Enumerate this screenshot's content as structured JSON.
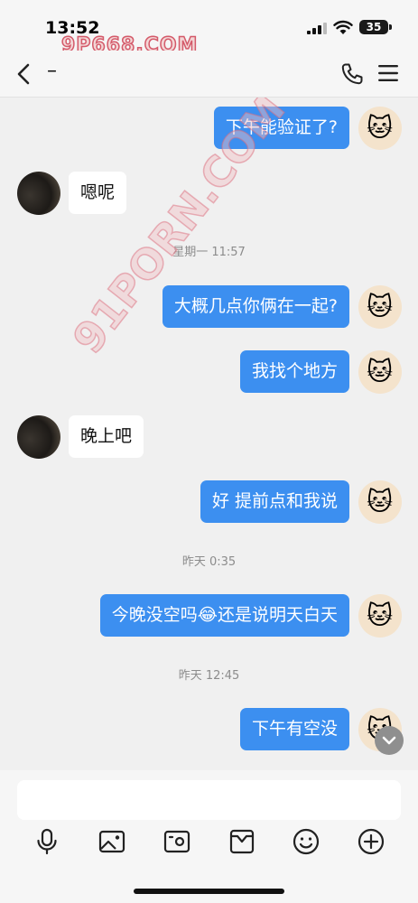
{
  "status_bar": {
    "time": "13:52",
    "battery": "35",
    "watermark": "9P668.COM"
  },
  "nav": {
    "contact_name": "–"
  },
  "watermark_diagonal": "91PORN.COM",
  "messages": [
    {
      "side": "out",
      "text": "下午能验证了?"
    },
    {
      "side": "in",
      "text": "嗯呢"
    },
    {
      "type": "time",
      "text": "星期一 11:57"
    },
    {
      "side": "out",
      "text": "大概几点你俩在一起?"
    },
    {
      "side": "out",
      "text": "我找个地方"
    },
    {
      "side": "in",
      "text": "晚上吧"
    },
    {
      "side": "out",
      "text": "好 提前点和我说"
    },
    {
      "type": "time",
      "text": "昨天 0:35"
    },
    {
      "side": "out",
      "text": "今晚没空吗😂还是说明天白天"
    },
    {
      "type": "time",
      "text": "昨天 12:45"
    },
    {
      "side": "out",
      "text": "下午有空没"
    }
  ],
  "toolbar": {
    "icons": [
      "microphone-icon",
      "image-icon",
      "video-icon",
      "package-icon",
      "emoji-icon",
      "plus-icon"
    ]
  },
  "colors": {
    "outgoing_bubble": "#3c8ff0",
    "incoming_bubble": "#ffffff",
    "background": "#f0f0f0"
  }
}
